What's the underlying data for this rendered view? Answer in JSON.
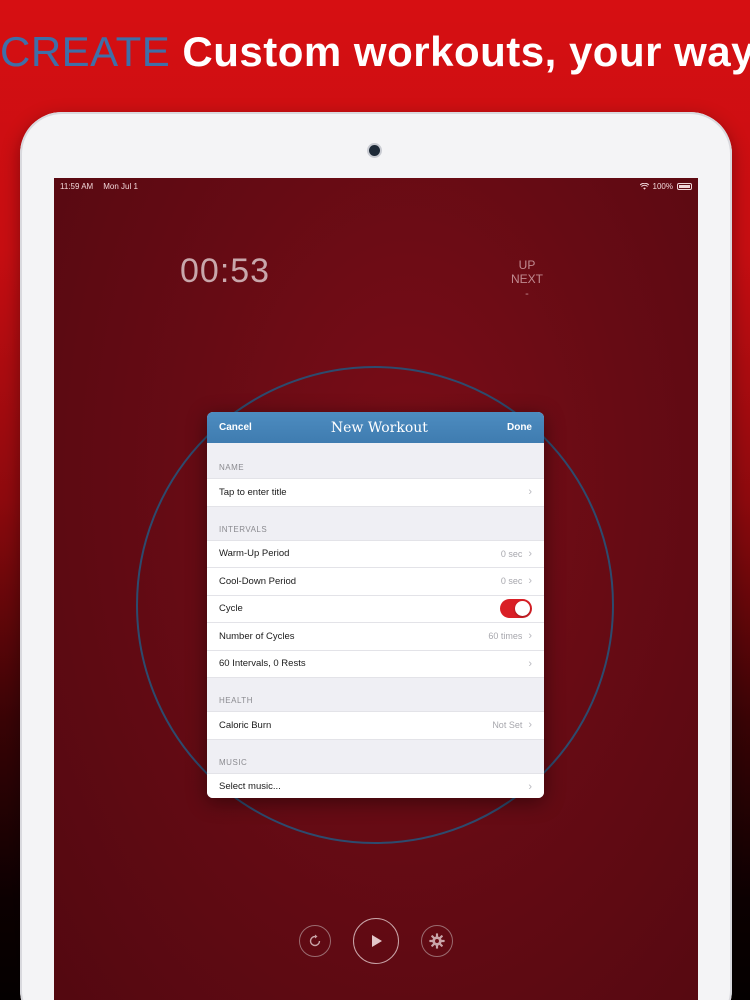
{
  "headline": {
    "accent": "CREATE",
    "rest": "Custom workouts, your way"
  },
  "status_bar": {
    "time": "11:59 AM",
    "date": "Mon Jul 1",
    "battery": "100%"
  },
  "timer": {
    "display": "00:53"
  },
  "up_next": {
    "label": "UP NEXT",
    "value": "-"
  },
  "modal": {
    "cancel": "Cancel",
    "title": "New Workout",
    "done": "Done",
    "sections": {
      "name": "NAME",
      "intervals": "INTERVALS",
      "health": "HEALTH",
      "music": "MUSIC"
    },
    "rows": {
      "title": {
        "label": "Tap to enter title"
      },
      "warmup": {
        "label": "Warm-Up Period",
        "value": "0 sec"
      },
      "cooldown": {
        "label": "Cool-Down Period",
        "value": "0 sec"
      },
      "cycle": {
        "label": "Cycle",
        "on": true
      },
      "cycles": {
        "label": "Number of Cycles",
        "value": "60 times"
      },
      "intervals": {
        "label": "60 Intervals, 0 Rests"
      },
      "caloric": {
        "label": "Caloric Burn",
        "value": "Not Set"
      },
      "music": {
        "label": "Select music..."
      }
    }
  },
  "colors": {
    "accent_blue": "#3f6fa8",
    "header_blue": "#4d8cc0",
    "toggle_red": "#d91f26"
  },
  "icons": {
    "restart": "restart-icon",
    "play": "play-icon",
    "settings": "gear-icon",
    "chevron": "chevron-right-icon"
  }
}
